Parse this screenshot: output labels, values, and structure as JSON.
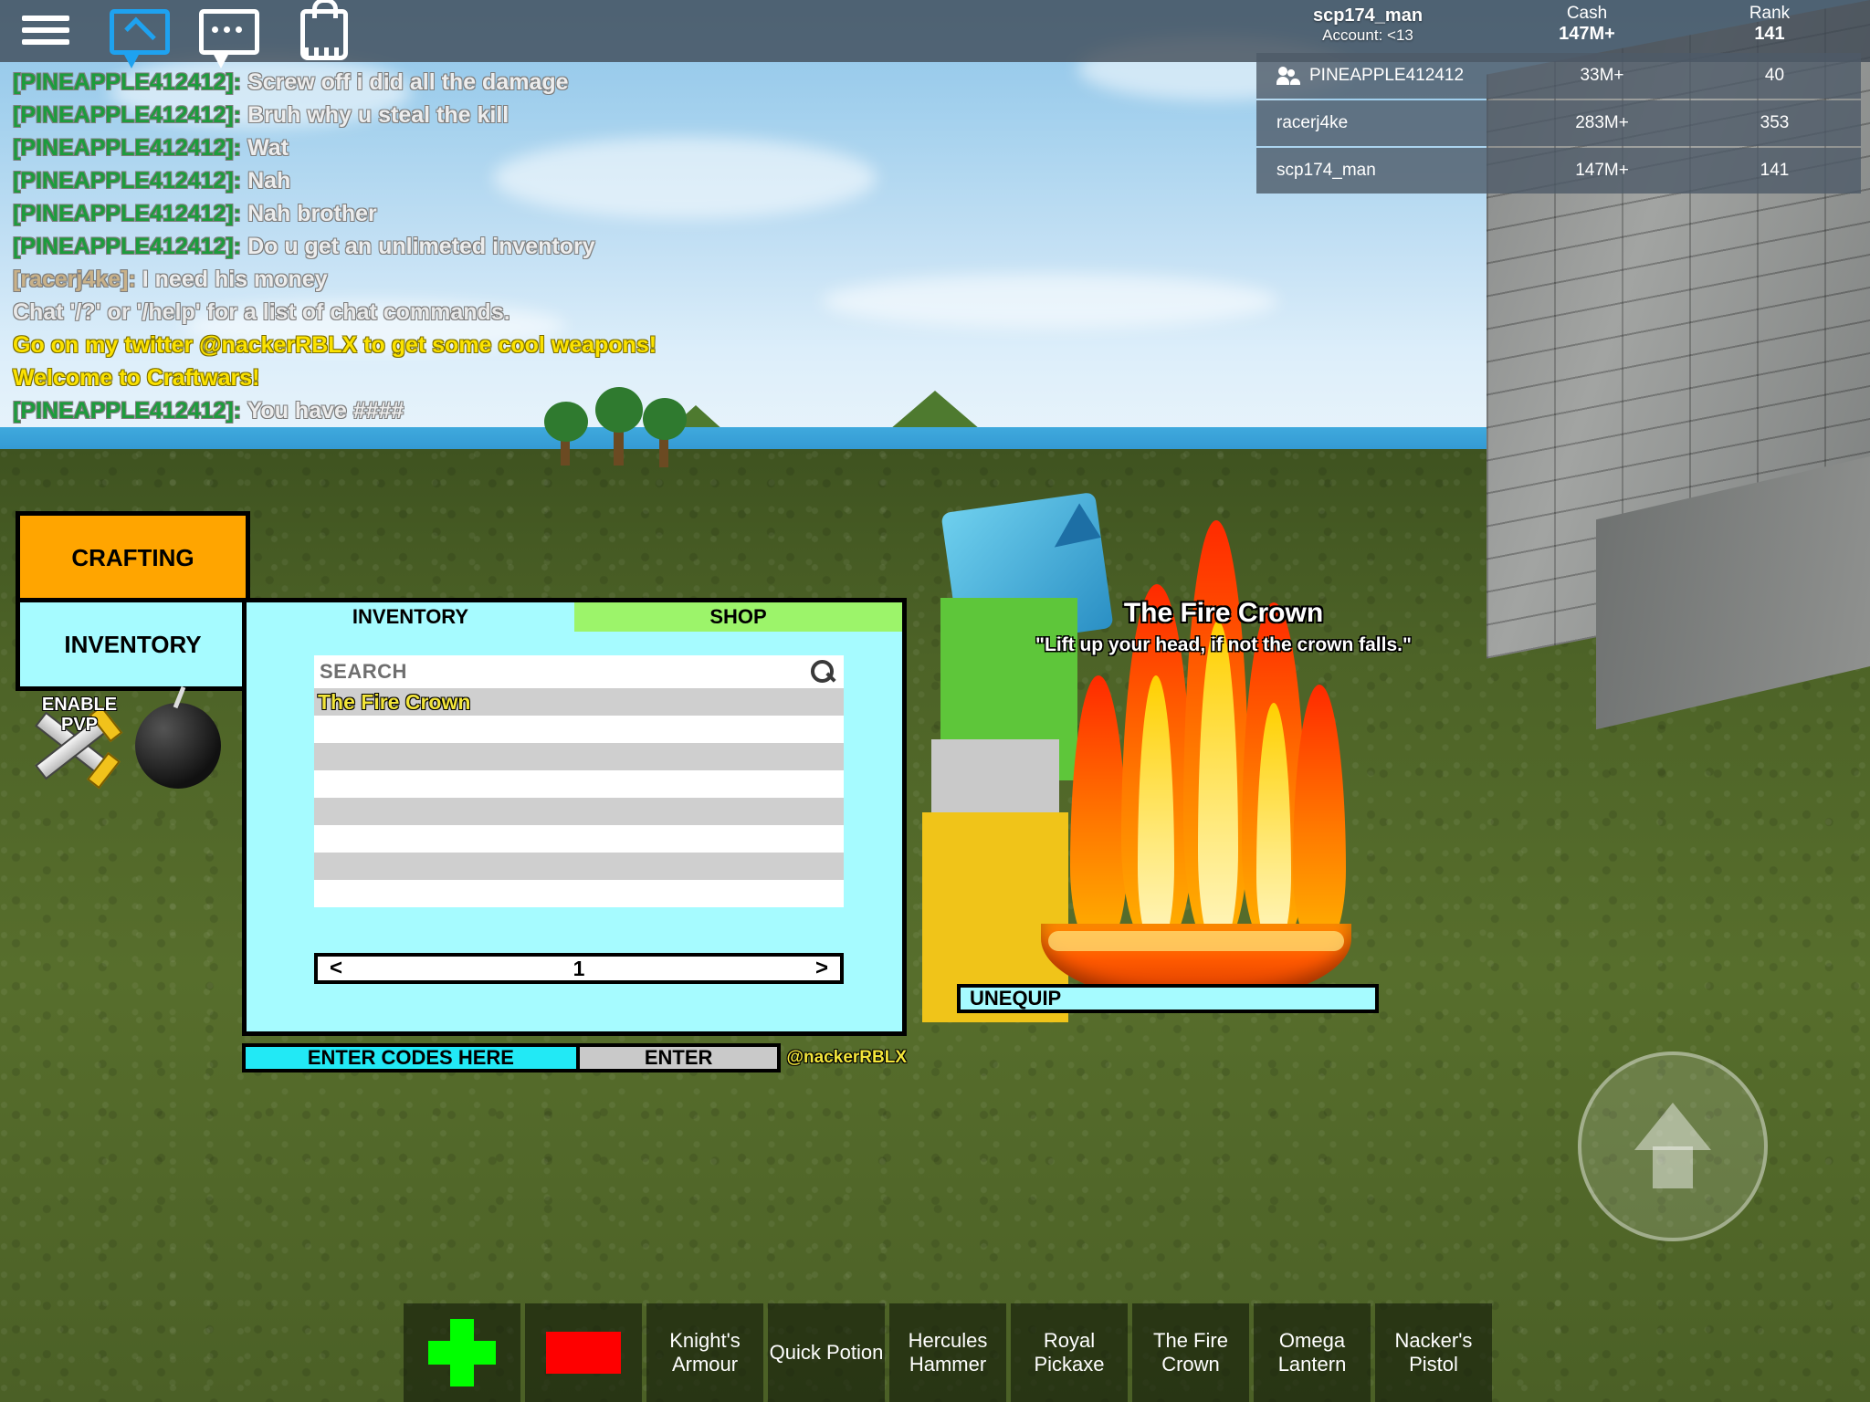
{
  "topbar": {
    "icons": [
      {
        "name": "menu-icon",
        "label": "Menu"
      },
      {
        "name": "emote-icon",
        "label": "Emotes"
      },
      {
        "name": "chat-icon",
        "label": "Chat"
      },
      {
        "name": "backpack-icon",
        "label": "Backpack"
      }
    ]
  },
  "player": {
    "name": "scp174_man",
    "account": "Account: <13"
  },
  "leaderboard": {
    "headers": [
      "Cash",
      "Rank"
    ],
    "self": {
      "cash": "147M+",
      "rank": "141"
    },
    "rows": [
      {
        "name": "PINEAPPLE412412",
        "cash": "33M+",
        "rank": "40",
        "icon": "people-icon"
      },
      {
        "name": "racerj4ke",
        "cash": "283M+",
        "rank": "353",
        "icon": ""
      },
      {
        "name": "scp174_man",
        "cash": "147M+",
        "rank": "141",
        "icon": ""
      }
    ]
  },
  "chat": {
    "lines": [
      {
        "speaker": "[PINEAPPLE412412]:",
        "speaker_color": "green",
        "text": "Screw off i did all the damage"
      },
      {
        "speaker": "[PINEAPPLE412412]:",
        "speaker_color": "green",
        "text": "Bruh why u steal the kill"
      },
      {
        "speaker": "[PINEAPPLE412412]:",
        "speaker_color": "green",
        "text": "Wat"
      },
      {
        "speaker": "[PINEAPPLE412412]:",
        "speaker_color": "green",
        "text": "Nah"
      },
      {
        "speaker": "[PINEAPPLE412412]:",
        "speaker_color": "green",
        "text": "Nah brother"
      },
      {
        "speaker": "[PINEAPPLE412412]:",
        "speaker_color": "green",
        "text": "Do u get an unlimeted inventory"
      },
      {
        "speaker": "[racerj4ke]:",
        "speaker_color": "tan",
        "text": "I need his money"
      },
      {
        "speaker": "",
        "speaker_color": "",
        "text": "Chat '/?' or '/help' for a list of chat commands."
      },
      {
        "speaker": "",
        "speaker_color": "yellow",
        "text": "Go on my twitter @nackerRBLX to get some cool weapons!"
      },
      {
        "speaker": "",
        "speaker_color": "yellow",
        "text": "Welcome to Craftwars!"
      },
      {
        "speaker": "[PINEAPPLE412412]:",
        "speaker_color": "green",
        "text": "You have ####"
      }
    ]
  },
  "sidebuttons": {
    "crafting": "CRAFTING",
    "inventory": "INVENTORY",
    "pvp": "ENABLE PVP",
    "bomb": "bomb-icon"
  },
  "inventory_panel": {
    "tabs": [
      {
        "label": "INVENTORY",
        "active": true
      },
      {
        "label": "SHOP",
        "active": false
      }
    ],
    "search": {
      "label": "SEARCH",
      "placeholder": "SEARCH",
      "value": "",
      "icon": "search-icon"
    },
    "items": [
      {
        "label": "The Fire Crown"
      },
      {
        "label": ""
      },
      {
        "label": ""
      },
      {
        "label": ""
      },
      {
        "label": ""
      },
      {
        "label": ""
      },
      {
        "label": ""
      },
      {
        "label": ""
      }
    ],
    "pager": {
      "prev": "<",
      "page": "1",
      "next": ">"
    },
    "codes": {
      "placeholder": "ENTER CODES HERE",
      "value": "",
      "enter": "ENTER",
      "twitter": "@nackerRBLX"
    }
  },
  "showcase": {
    "title": "The Fire Crown",
    "quote": "\"Lift up your head, if not the crown falls.\"",
    "unequip": "UNEQUIP"
  },
  "hotbar": {
    "slots": [
      {
        "label": "",
        "icon": "green-plus-icon"
      },
      {
        "label": "",
        "icon": "red-bar-icon"
      },
      {
        "label": "Knight's Armour",
        "icon": ""
      },
      {
        "label": "Quick Potion",
        "icon": ""
      },
      {
        "label": "Hercules Hammer",
        "icon": ""
      },
      {
        "label": "Royal Pickaxe",
        "icon": ""
      },
      {
        "label": "The Fire Crown",
        "icon": ""
      },
      {
        "label": "Omega Lantern",
        "icon": ""
      },
      {
        "label": "Nacker's Pistol",
        "icon": ""
      }
    ]
  },
  "controls": {
    "joystick": "movement-joystick"
  },
  "colors": {
    "accent_cyan": "#a6fbff",
    "accent_orange": "#ffa500",
    "shop_green": "#9cf46a",
    "codes_cyan": "#22e9f5",
    "chat_name_green": "#1c9c3c",
    "chat_yellow": "#fbe200",
    "item_yellow": "#f2e53a"
  }
}
